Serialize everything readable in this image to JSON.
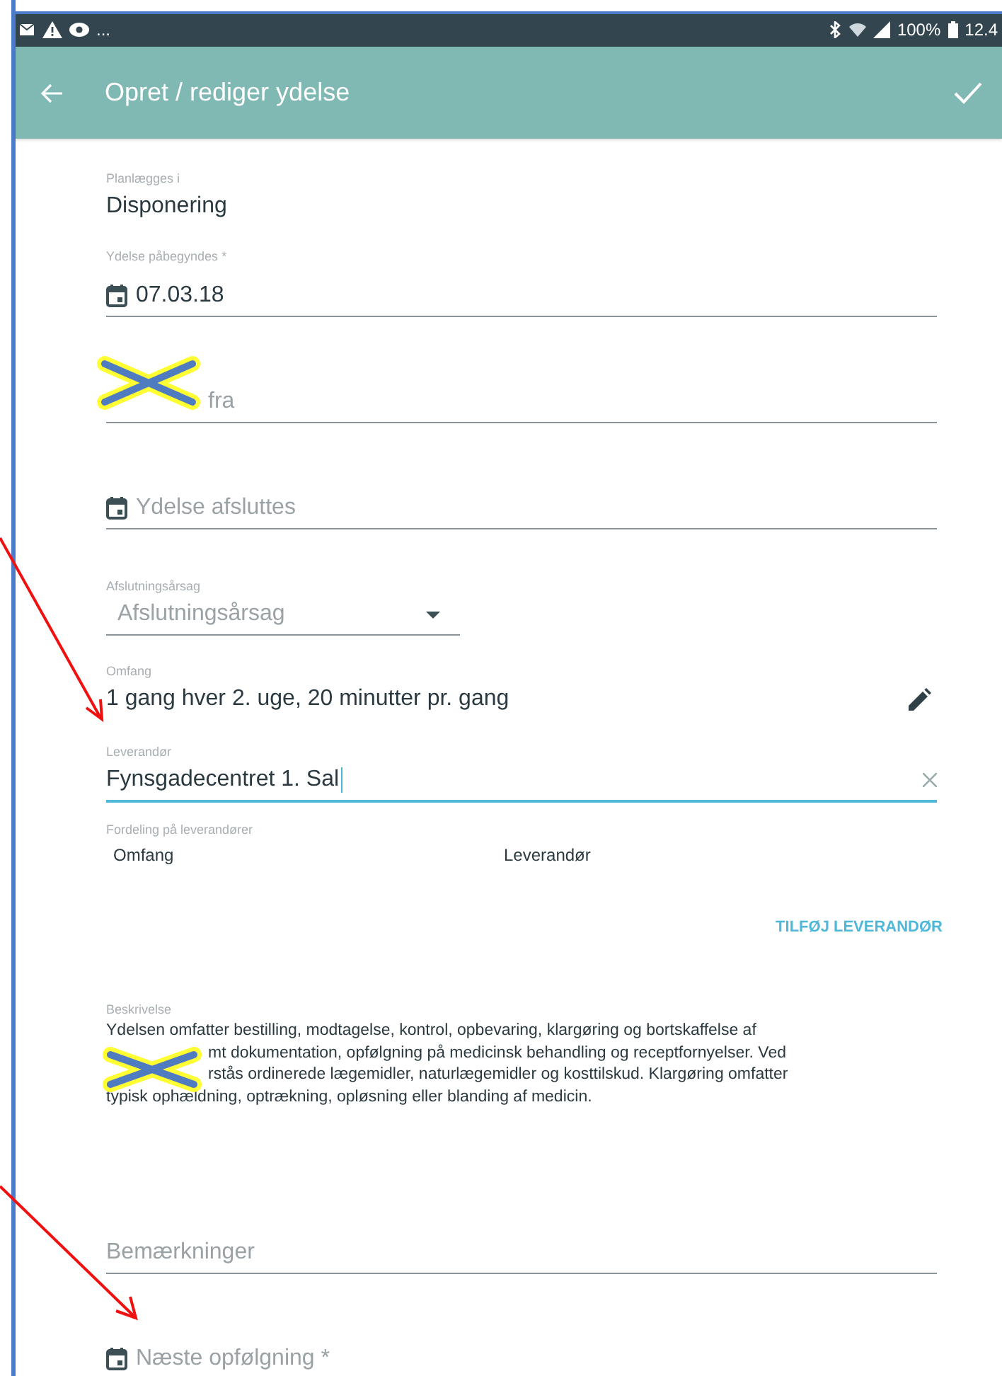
{
  "status_bar": {
    "notifications": "...",
    "battery": "100%",
    "time": "12.4"
  },
  "app_bar": {
    "title": "Opret / rediger ydelse"
  },
  "fields": [
    {
      "kind": "static",
      "label": "Planlægges i",
      "value": "Disponering"
    },
    {
      "kind": "date",
      "label": "Ydelse påbegyndes *",
      "value": "07.03.18"
    },
    {
      "kind": "text",
      "placeholder": "fra",
      "partial": true
    },
    {
      "kind": "date",
      "placeholder": "Ydelse afsluttes"
    },
    {
      "kind": "select",
      "label": "Afslutningsårsag",
      "placeholder": "Afslutningsårsag"
    },
    {
      "kind": "edit_text",
      "label": "Omfang",
      "value": "1 gang hver 2. uge, 20 minutter pr. gang"
    },
    {
      "kind": "input",
      "label": "Leverandør",
      "value": "Fynsgadecentret 1. Sal",
      "focused": true
    },
    {
      "kind": "table",
      "label": "Fordeling på leverandører",
      "columns": [
        "Omfang",
        "Leverandør"
      ]
    },
    {
      "kind": "action",
      "label": "TILFØJ LEVERANDØR"
    },
    {
      "kind": "paragraph",
      "label": "Beskrivelse",
      "lines": [
        {
          "text": "Ydelsen omfatter bestilling, modtagelse, kontrol, opbevaring, klargøring og bortskaffelse af",
          "partial": false
        },
        {
          "text": "mt dokumentation, opfølgning på medicinsk behandling og receptfornyelser. Ved",
          "partial": true
        },
        {
          "text": "rstås ordinerede lægemidler, naturlægemidler og kosttilskud. Klargøring omfatter",
          "partial": true
        },
        {
          "text": "typisk ophældning, optrækning, opløsning eller blanding af medicin.",
          "partial": false
        }
      ]
    },
    {
      "kind": "text",
      "placeholder": "Bemærkninger",
      "partial": false
    },
    {
      "kind": "date",
      "placeholder": "Næste opfølgning *"
    }
  ]
}
